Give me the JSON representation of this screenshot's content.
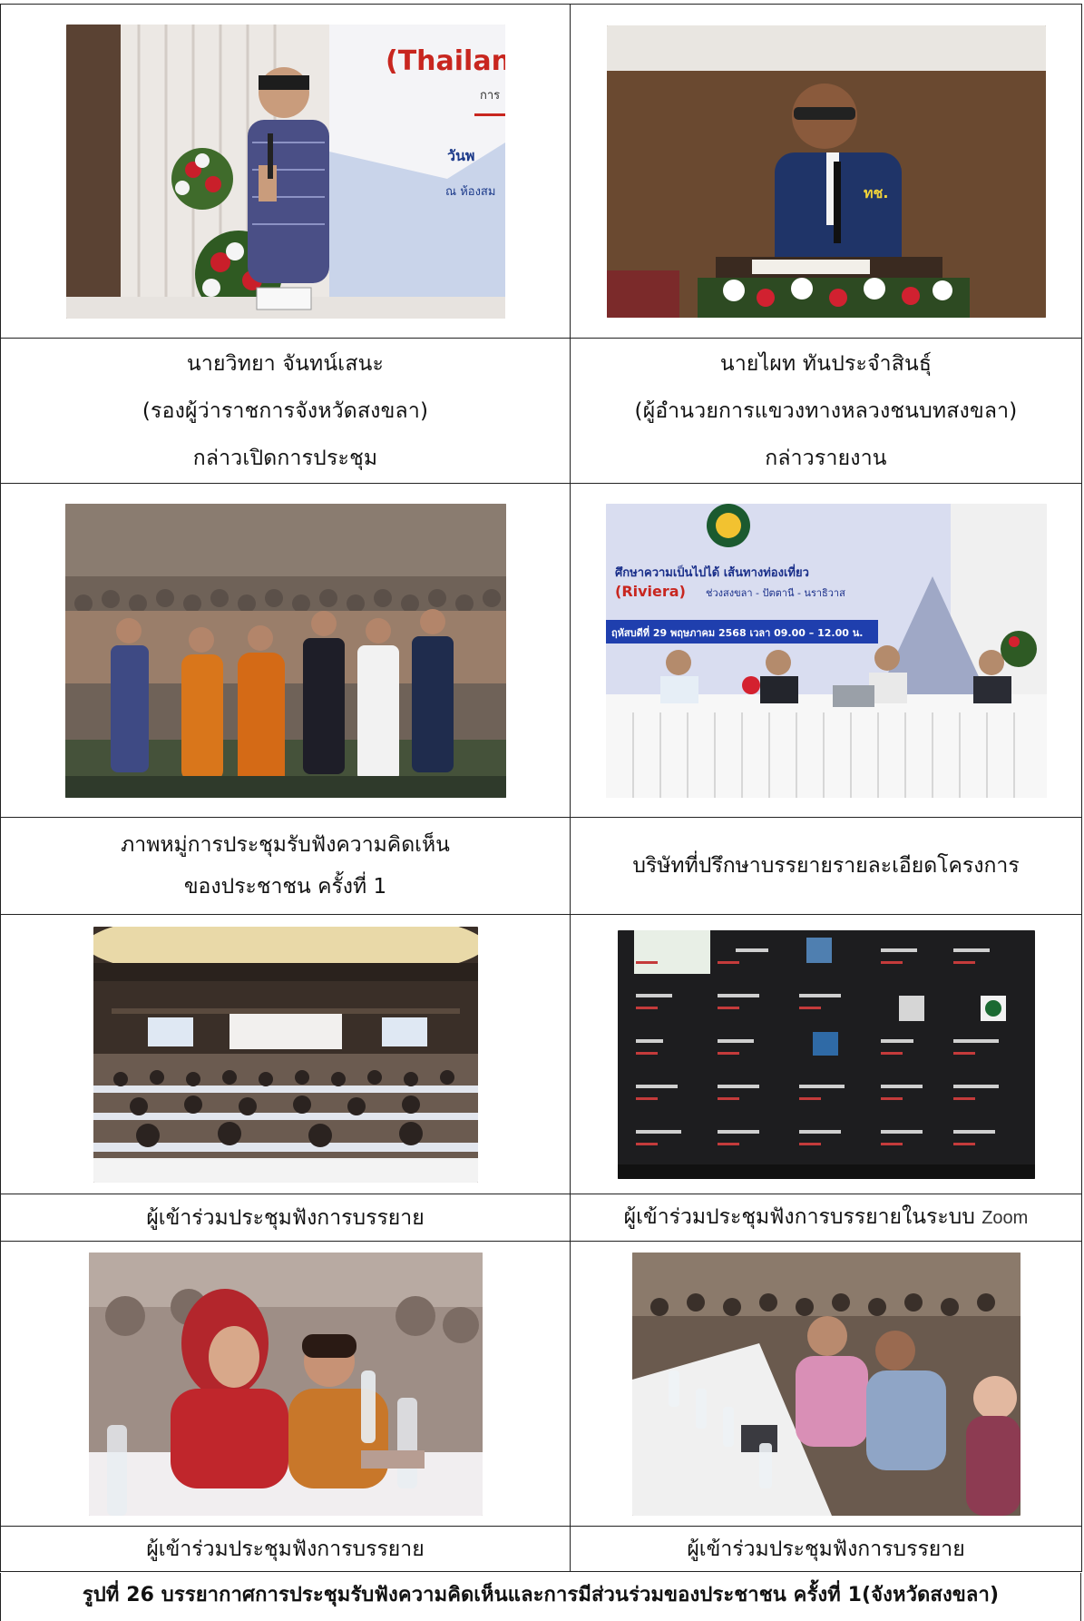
{
  "cells": {
    "r1c1": {
      "lines": [
        "นายวิทยา จันทน์เสนะ",
        "(รองผู้ว่าราชการจังหวัดสงขลา)",
        "กล่าวเปิดการประชุม"
      ]
    },
    "r1c2": {
      "lines": [
        "นายไผท ทันประจำสินธุ์",
        "(ผู้อำนวยการแขวงทางหลวงชนบทสงขลา)",
        "กล่าวรายงาน"
      ]
    },
    "r2c1": {
      "lines": [
        "ภาพหมู่การประชุมรับฟังความคิดเห็น",
        "ของประชาชน ครั้งที่ 1"
      ]
    },
    "r2c2": {
      "lines": [
        "บริษัทที่ปรึกษาบรรยายรายละเอียดโครงการ"
      ]
    },
    "r3c1": {
      "text": "ผู้เข้าร่วมประชุมฟังการบรรยาย"
    },
    "r3c2": {
      "text": "ผู้เข้าร่วมประชุมฟังการบรรยายในระบบ",
      "suffix": "Zoom"
    },
    "r4c1": {
      "text": "ผู้เข้าร่วมประชุมฟังการบรรยาย"
    },
    "r4c2": {
      "text": "ผู้เข้าร่วมประชุมฟังการบรรยาย"
    }
  },
  "photo_text": {
    "banner1_line1": "(Thailand",
    "banner1_line2": "วันพ",
    "banner1_line3": "ณ ห้องสม",
    "banner1_line4": "การ",
    "slide_heading": "(Riviera)",
    "slide_route": "ช่วงสงขลา - ปัตตานี - นราธิวาส",
    "slide_date": "ฤหัสบดีที่ 29 พฤษภาคม 2568 เวลา 09.00 – 12.00 น."
  },
  "figure_caption": "รูปที่ 26 บรรยากาศการประชุมรับฟังความคิดเห็นและการมีส่วนร่วมของประชาชน ครั้งที่ 1(จังหวัดสงขลา)"
}
